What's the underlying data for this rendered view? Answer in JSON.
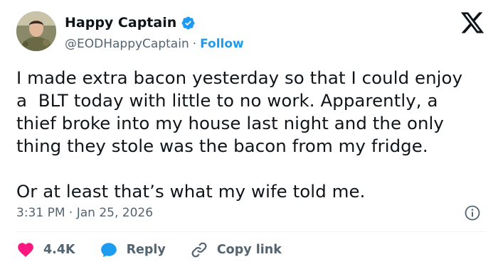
{
  "author": {
    "display_name": "Happy Captain",
    "handle": "@EODHappyCaptain",
    "separator": "·",
    "follow_label": "Follow",
    "verified_color": "#1d9bf0"
  },
  "tweet": {
    "paragraph_1": "I made extra bacon yesterday so that I could enjoy\na  BLT today with little to no work. Apparently, a\nthief broke into my house last night and the only\nthing they stole was the bacon from my fridge.",
    "paragraph_2": "Or at least that’s what my wife told me."
  },
  "meta": {
    "timestamp": "3:31 PM · Jan 25, 2026"
  },
  "actions": {
    "like_count": "4.4K",
    "reply_label": "Reply",
    "copy_link_label": "Copy link"
  },
  "colors": {
    "like": "#f91880",
    "reply": "#1d9bf0",
    "secondary_text": "#536471",
    "link": "#1d9bf0"
  },
  "icons": [
    "verified-badge-icon",
    "x-logo-icon",
    "info-icon",
    "heart-icon",
    "reply-bubble-icon",
    "link-icon"
  ]
}
